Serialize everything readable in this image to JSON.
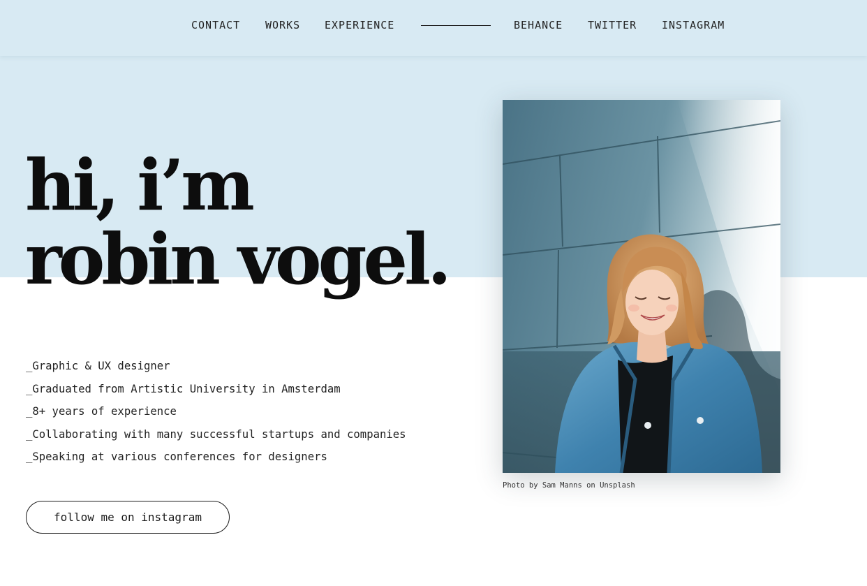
{
  "nav": {
    "links": [
      {
        "label": "CONTACT"
      },
      {
        "label": "WORKS"
      },
      {
        "label": "EXPERIENCE"
      },
      {
        "label": "BEHANCE"
      },
      {
        "label": "TWITTER"
      },
      {
        "label": "INSTAGRAM"
      }
    ]
  },
  "hero": {
    "title_line1": "hi, i’m",
    "title_line2": "robin vogel.",
    "bullets": [
      "_Graphic & UX designer",
      "_Graduated from Artistic University in Amsterdam",
      "_8+ years of experience",
      "_Collaborating with many successful startups and companies",
      "_Speaking at various conferences for designers"
    ],
    "cta_label": "follow me on instagram"
  },
  "photo": {
    "credit": "Photo by Sam Manns on Unsplash"
  },
  "colors": {
    "background_band": "#d8eaf3",
    "text": "#1a1a1a",
    "page_background": "#ffffff"
  }
}
